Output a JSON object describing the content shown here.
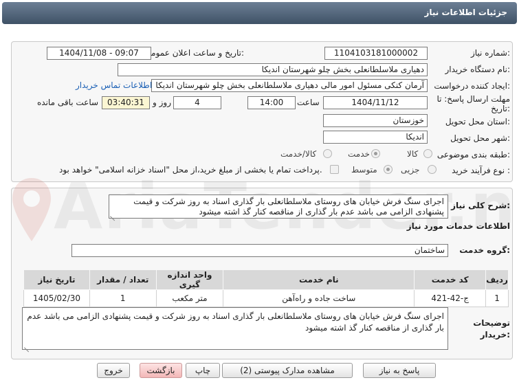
{
  "header": {
    "title": "جزئیات اطلاعات نیاز"
  },
  "form": {
    "need_number": {
      "label": "شماره نیاز:",
      "value": "1104103181000002"
    },
    "announce_datetime": {
      "label": "تاریخ و ساعت اعلان عمومی:",
      "value": "1404/11/08 - 09:07"
    },
    "buyer_org": {
      "label": "نام دستگاه خریدار:",
      "value": "دهیاری ملاسلطانعلی بخش چلو شهرستان اندیکا"
    },
    "requester": {
      "label": "ایجاد کننده درخواست:",
      "value": "آرمان کنکی مسئول امور مالی دهیاری ملاسلطانعلی بخش چلو شهرستان اندیکا",
      "link": "اطلاعات تماس خریدار"
    },
    "deadline": {
      "label": "مهلت ارسال پاسخ: تا تاریخ:",
      "date": "1404/11/12",
      "time_label": "ساعت",
      "time": "14:00",
      "days": "4",
      "days_label": "روز و",
      "remaining": "03:40:31",
      "remaining_label": "ساعت باقی مانده"
    },
    "province": {
      "label": "استان محل تحویل:",
      "value": "خوزستان"
    },
    "city": {
      "label": "شهر محل تحویل:",
      "value": "اندیکا"
    },
    "category": {
      "label": "طبقه بندی موضوعی:",
      "options": [
        "کالا",
        "خدمت",
        "کالا/خدمت"
      ],
      "selected": "خدمت"
    },
    "process": {
      "label": "نوع فرآیند خرید :",
      "options": [
        "جزیی",
        "متوسط"
      ],
      "selected": "متوسط",
      "note": "پرداخت تمام یا بخشی از مبلغ خرید،از محل \"اسناد خزانه اسلامی\" خواهد بود."
    }
  },
  "summary": {
    "label": "شرح کلی نیاز:",
    "text": "اجرای سنگ فرش خیابان های روستای ملاسلطانعلی بار گذاری اسناد به روز شرکت و قیمت پشنهادی الزامی می باشد عدم بار گذاری از مناقصه کنار گذ اشته میشود"
  },
  "services": {
    "section_title": "اطلاعات خدمات مورد نیاز",
    "group_label": "گروه خدمت:",
    "group_value": "ساختمان",
    "columns": [
      "ردیف",
      "کد خدمت",
      "نام خدمت",
      "واحد اندازه گیری",
      "تعداد / مقدار",
      "تاریخ نیاز"
    ],
    "rows": [
      {
        "row": "1",
        "code": "ج-42-421",
        "name": "ساخت جاده و راه‌آهن",
        "unit": "متر مکعب",
        "qty": "1",
        "date": "1405/02/30"
      }
    ]
  },
  "buyer_notes": {
    "label": "توضیحات خریدار:",
    "text": "اجرای سنگ فرش خیابان های روستای ملاسلطانعلی بار گذاری اسناد به روز شرکت و قیمت پشنهادی الزامی می باشد عدم بار گذاری از مناقصه کنار گذ اشته میشود"
  },
  "buttons": {
    "reply": "پاسخ به نیاز",
    "attachments": "مشاهده مدارک پیوستی (2)",
    "print": "چاپ",
    "back": "بازگشت",
    "exit": "خروج"
  },
  "watermark": {
    "text": "AriaTender.net"
  },
  "colors": {
    "title_bar": "#4f6278",
    "link": "#1a5fb4",
    "highlight": "#fbf6d3",
    "pink_button": "#f3b7b7"
  }
}
